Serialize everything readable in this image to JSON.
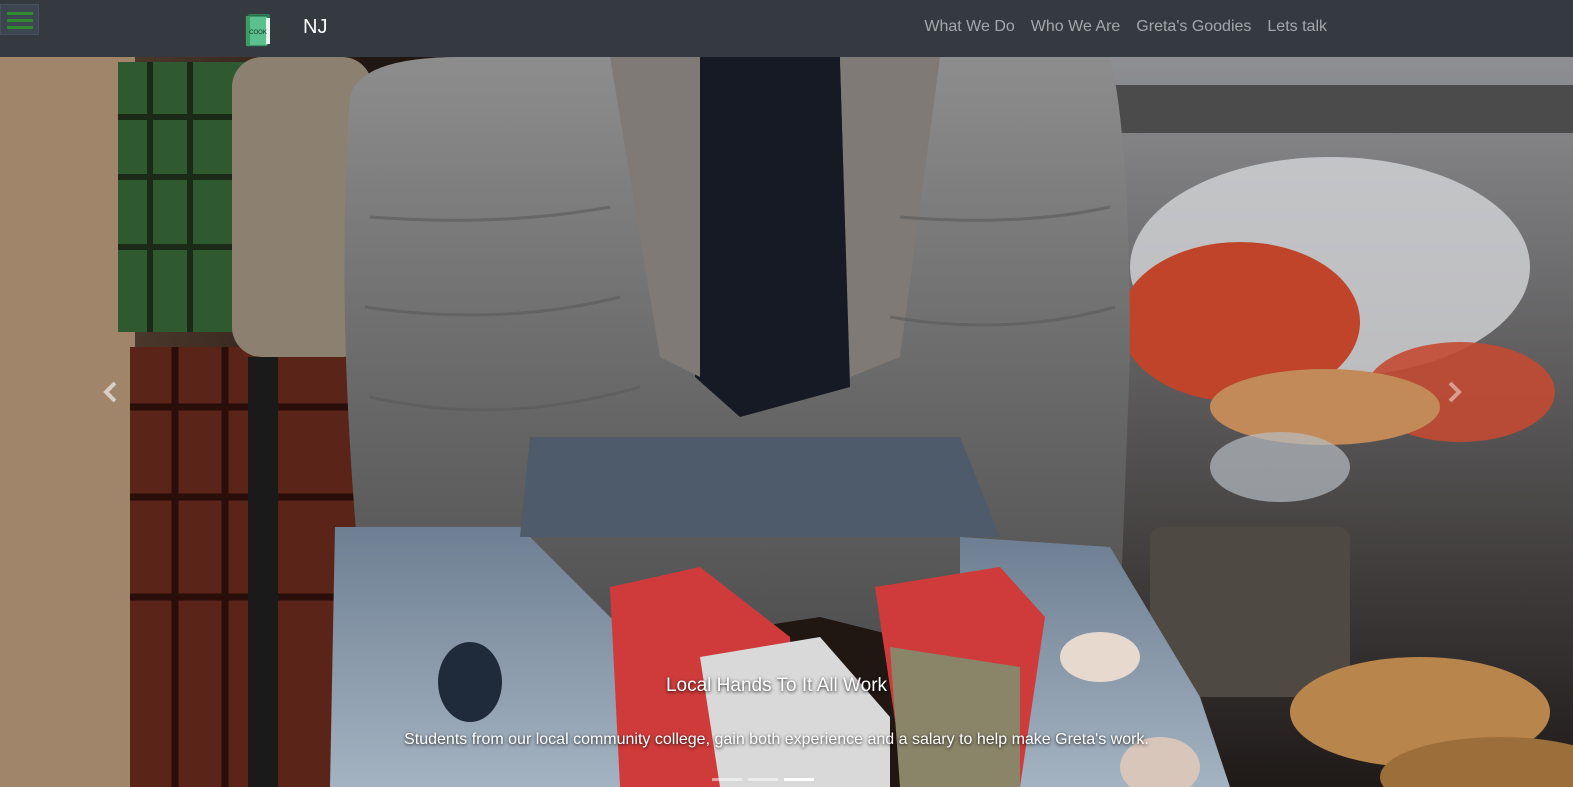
{
  "navbar": {
    "brand": "NJ",
    "logo_text": "COOK",
    "links": [
      "What We Do",
      "Who We Are",
      "Greta's Goodies",
      "Lets talk"
    ]
  },
  "carousel": {
    "caption_title": "Local Hands To It All Work",
    "caption_text": "Students from our local community college, gain both experience and a salary to help make Greta's work.",
    "slide_count": 3,
    "active_slide": 3
  },
  "colors": {
    "navbar": "#343a40",
    "hamburger_bars": "#2e8b2e",
    "logo_book": "#4fae7d",
    "link": "rgba(255,255,255,0.55)"
  },
  "icons": {
    "menu": "hamburger-icon",
    "logo": "cook-book-icon",
    "prev": "chevron-left-icon",
    "next": "chevron-right-icon"
  }
}
